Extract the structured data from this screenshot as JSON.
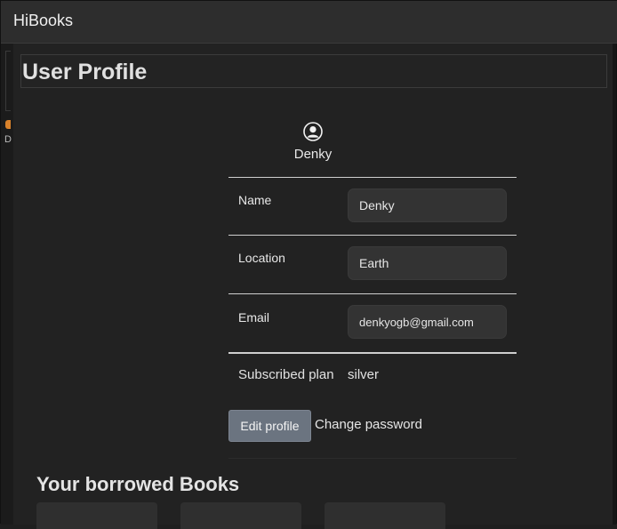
{
  "app": {
    "title": "HiBooks"
  },
  "left_strip": {
    "glyph": "D"
  },
  "page": {
    "title": "User Profile"
  },
  "profile": {
    "avatar_icon": "user-avatar-icon",
    "username": "Denky",
    "fields": [
      {
        "label": "Name",
        "value": "Denky"
      },
      {
        "label": "Location",
        "value": "Earth"
      },
      {
        "label": "Email",
        "value": "denkyogb@gmail.com"
      }
    ],
    "plan": {
      "label": "Subscribed plan",
      "value": "silver"
    },
    "actions": {
      "edit_label": "Edit profile",
      "change_password_label": "Change password"
    }
  },
  "borrowed": {
    "title": "Your borrowed Books",
    "books": [
      {},
      {},
      {}
    ]
  },
  "colors": {
    "background": "#222222",
    "titlebar": "#2d2d2d",
    "input_bg": "#333333",
    "button_bg": "#6b7480",
    "accent_dot": "#d9822b"
  }
}
